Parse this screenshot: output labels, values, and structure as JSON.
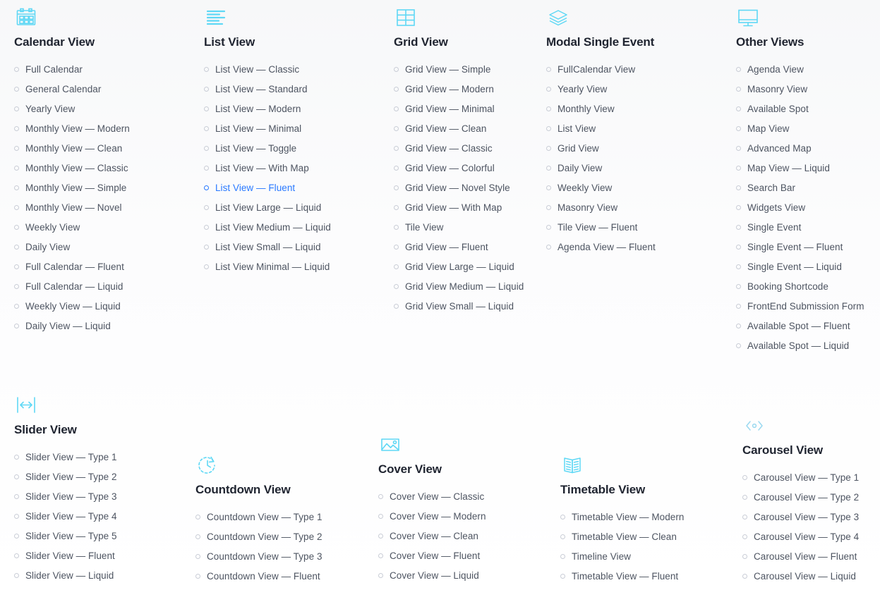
{
  "theme": {
    "accent_icon_color": "#5fd8f5",
    "active_item_color": "#2979ff",
    "heading_color": "#1f2430",
    "item_color": "#4d5461",
    "background_color": "#fbfbfc"
  },
  "columns": [
    {
      "id": "calendar",
      "icon": "calendar-icon",
      "title": "Calendar View",
      "items": [
        {
          "label": "Full Calendar",
          "active": false
        },
        {
          "label": "General Calendar",
          "active": false
        },
        {
          "label": "Yearly View",
          "active": false
        },
        {
          "label": "Monthly View — Modern",
          "active": false
        },
        {
          "label": "Monthly View — Clean",
          "active": false
        },
        {
          "label": "Monthly View — Classic",
          "active": false
        },
        {
          "label": "Monthly View — Simple",
          "active": false
        },
        {
          "label": "Monthly View — Novel",
          "active": false
        },
        {
          "label": "Weekly View",
          "active": false
        },
        {
          "label": "Daily View",
          "active": false
        },
        {
          "label": "Full Calendar — Fluent",
          "active": false
        },
        {
          "label": "Full Calendar — Liquid",
          "active": false
        },
        {
          "label": "Weekly View — Liquid",
          "active": false
        },
        {
          "label": "Daily View — Liquid",
          "active": false
        }
      ]
    },
    {
      "id": "list",
      "icon": "list-lines-icon",
      "title": "List View",
      "items": [
        {
          "label": "List View — Classic",
          "active": false
        },
        {
          "label": "List View — Standard",
          "active": false
        },
        {
          "label": "List View — Modern",
          "active": false
        },
        {
          "label": "List View — Minimal",
          "active": false
        },
        {
          "label": "List View — Toggle",
          "active": false
        },
        {
          "label": "List View — With Map",
          "active": false
        },
        {
          "label": "List View — Fluent",
          "active": true
        },
        {
          "label": "List View Large — Liquid",
          "active": false
        },
        {
          "label": "List View Medium — Liquid",
          "active": false
        },
        {
          "label": "List View Small — Liquid",
          "active": false
        },
        {
          "label": "List View Minimal — Liquid",
          "active": false
        }
      ]
    },
    {
      "id": "grid",
      "icon": "grid-table-icon",
      "title": "Grid View",
      "items": [
        {
          "label": "Grid View — Simple",
          "active": false
        },
        {
          "label": "Grid View — Modern",
          "active": false
        },
        {
          "label": "Grid View — Minimal",
          "active": false
        },
        {
          "label": "Grid View — Clean",
          "active": false
        },
        {
          "label": "Grid View — Classic",
          "active": false
        },
        {
          "label": "Grid View — Colorful",
          "active": false
        },
        {
          "label": "Grid View — Novel Style",
          "active": false
        },
        {
          "label": "Grid View — With Map",
          "active": false
        },
        {
          "label": "Tile View",
          "active": false
        },
        {
          "label": "Grid View — Fluent",
          "active": false
        },
        {
          "label": "Grid View Large — Liquid",
          "active": false
        },
        {
          "label": "Grid View Medium — Liquid",
          "active": false
        },
        {
          "label": "Grid View Small — Liquid",
          "active": false
        }
      ]
    },
    {
      "id": "modal",
      "icon": "layers-icon",
      "title": "Modal Single Event",
      "items": [
        {
          "label": "FullCalendar View",
          "active": false
        },
        {
          "label": "Yearly View",
          "active": false
        },
        {
          "label": "Monthly View",
          "active": false
        },
        {
          "label": "List View",
          "active": false
        },
        {
          "label": "Grid View",
          "active": false
        },
        {
          "label": "Daily View",
          "active": false
        },
        {
          "label": "Weekly View",
          "active": false
        },
        {
          "label": "Masonry View",
          "active": false
        },
        {
          "label": "Tile View — Fluent",
          "active": false
        },
        {
          "label": "Agenda View — Fluent",
          "active": false
        }
      ]
    },
    {
      "id": "other",
      "icon": "monitor-icon",
      "title": "Other Views",
      "items": [
        {
          "label": "Agenda View",
          "active": false
        },
        {
          "label": "Masonry View",
          "active": false
        },
        {
          "label": "Available Spot",
          "active": false
        },
        {
          "label": "Map View",
          "active": false
        },
        {
          "label": "Advanced Map",
          "active": false
        },
        {
          "label": "Map View — Liquid",
          "active": false
        },
        {
          "label": "Search Bar",
          "active": false
        },
        {
          "label": "Widgets View",
          "active": false
        },
        {
          "label": "Single Event",
          "active": false
        },
        {
          "label": "Single Event — Fluent",
          "active": false
        },
        {
          "label": "Single Event — Liquid",
          "active": false
        },
        {
          "label": "Booking Shortcode",
          "active": false
        },
        {
          "label": "FrontEnd Submission Form",
          "active": false
        },
        {
          "label": "Available Spot — Fluent",
          "active": false
        },
        {
          "label": "Available Spot — Liquid",
          "active": false
        }
      ]
    },
    {
      "id": "slider",
      "icon": "slider-arrows-icon",
      "title": "Slider View",
      "items": [
        {
          "label": "Slider View — Type 1",
          "active": false
        },
        {
          "label": "Slider View — Type 2",
          "active": false
        },
        {
          "label": "Slider View — Type 3",
          "active": false
        },
        {
          "label": "Slider View — Type 4",
          "active": false
        },
        {
          "label": "Slider View — Type 5",
          "active": false
        },
        {
          "label": "Slider View — Fluent",
          "active": false
        },
        {
          "label": "Slider View — Liquid",
          "active": false
        }
      ]
    },
    {
      "id": "countdown",
      "icon": "countdown-clock-icon",
      "title": "Countdown View",
      "items": [
        {
          "label": "Countdown View — Type 1",
          "active": false
        },
        {
          "label": "Countdown View — Type 2",
          "active": false
        },
        {
          "label": "Countdown View — Type 3",
          "active": false
        },
        {
          "label": "Countdown View — Fluent",
          "active": false
        }
      ]
    },
    {
      "id": "cover",
      "icon": "image-photo-icon",
      "title": "Cover View",
      "items": [
        {
          "label": "Cover View — Classic",
          "active": false
        },
        {
          "label": "Cover View — Modern",
          "active": false
        },
        {
          "label": "Cover View — Clean",
          "active": false
        },
        {
          "label": "Cover View — Fluent",
          "active": false
        },
        {
          "label": "Cover View — Liquid",
          "active": false
        }
      ]
    },
    {
      "id": "timetable",
      "icon": "open-book-icon",
      "title": "Timetable View",
      "items": [
        {
          "label": "Timetable View — Modern",
          "active": false
        },
        {
          "label": "Timetable View — Clean",
          "active": false
        },
        {
          "label": "Timeline View",
          "active": false
        },
        {
          "label": "Timetable View — Fluent",
          "active": false
        }
      ]
    },
    {
      "id": "carousel",
      "icon": "carousel-chevrons-icon",
      "title": "Carousel View",
      "items": [
        {
          "label": "Carousel View — Type 1",
          "active": false
        },
        {
          "label": "Carousel View — Type 2",
          "active": false
        },
        {
          "label": "Carousel View — Type 3",
          "active": false
        },
        {
          "label": "Carousel View — Type 4",
          "active": false
        },
        {
          "label": "Carousel View — Fluent",
          "active": false
        },
        {
          "label": "Carousel View — Liquid",
          "active": false
        }
      ]
    }
  ]
}
